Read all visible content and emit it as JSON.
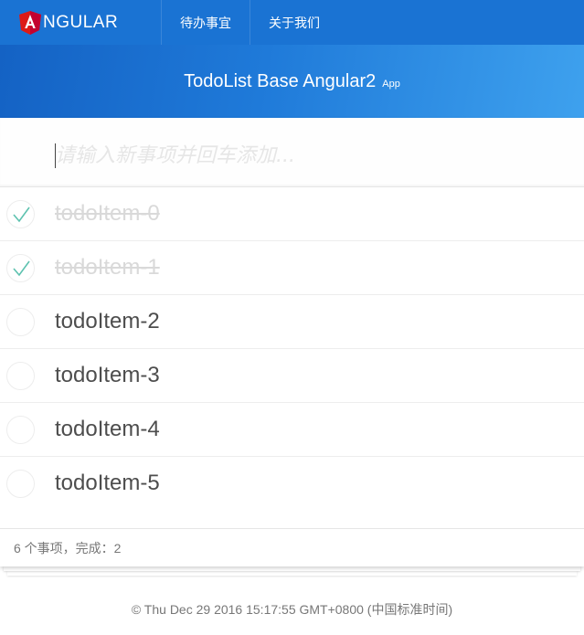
{
  "navbar": {
    "brand": "NGULAR",
    "logo_icon": "angular-shield-icon",
    "logo_color": "#dd1b16",
    "links": [
      "待办事宜",
      "关于我们"
    ],
    "background": "#1a73d3"
  },
  "banner": {
    "title": "TodoList Base Angular2",
    "subtitle": "App"
  },
  "new_todo": {
    "placeholder": "请输入新事项并回车添加...",
    "value": ""
  },
  "todos": [
    {
      "label": "todoItem-0",
      "completed": true
    },
    {
      "label": "todoItem-1",
      "completed": true
    },
    {
      "label": "todoItem-2",
      "completed": false
    },
    {
      "label": "todoItem-3",
      "completed": false
    },
    {
      "label": "todoItem-4",
      "completed": false
    },
    {
      "label": "todoItem-5",
      "completed": false
    }
  ],
  "footer": {
    "summary": "6 个事项，完成：2"
  },
  "copyright": "© Thu Dec 29 2016 15:17:55 GMT+0800 (中国标准时间)",
  "colors": {
    "check": "#5dc2af",
    "completed_text": "#d9d9d9",
    "text": "#4d4d4d"
  }
}
